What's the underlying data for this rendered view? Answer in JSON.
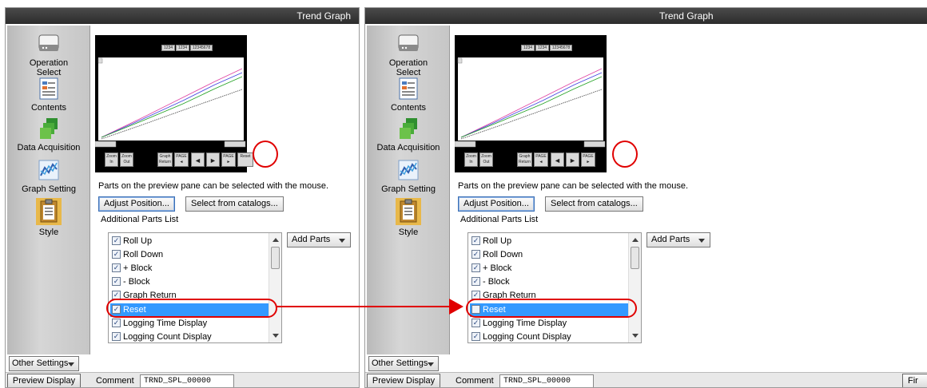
{
  "window": {
    "title": "Trend Graph"
  },
  "sidebar": {
    "items": [
      {
        "label": "Operation\nSelect",
        "icon": "drive-icon"
      },
      {
        "label": "Contents",
        "icon": "list-document-icon"
      },
      {
        "label": "Data Acquisition",
        "icon": "stacked-squares-icon"
      },
      {
        "label": "Graph Setting",
        "icon": "line-graph-icon"
      },
      {
        "label": "Style",
        "icon": "clipboard-icon",
        "active": true
      }
    ],
    "other_settings": "Other Settings"
  },
  "preview": {
    "header_boxes": [
      "1234",
      "1234",
      "12345678"
    ],
    "axis_left_top": "1",
    "axis_left_bottom": "12345678",
    "axis_right_bottom": "12345678",
    "controls": [
      {
        "label": "Zoom\nIn"
      },
      {
        "label": "Zoom\nOut"
      },
      {
        "label": "Graph\nReturn"
      },
      {
        "label": "PAGE\n◄"
      },
      {
        "label": "◄"
      },
      {
        "label": "►"
      },
      {
        "label": "PAGE\n►"
      },
      {
        "label": "Reset"
      },
      {
        "label": "Title"
      }
    ],
    "series_colors": [
      "#e040a0",
      "#4040e0",
      "#20a020",
      "#404040"
    ]
  },
  "hint": "Parts on the preview pane can be selected with the mouse.",
  "buttons": {
    "adjust_position": "Adjust Position...",
    "select_catalogs": "Select from catalogs..."
  },
  "additional_parts": {
    "header": "Additional Parts List",
    "add_parts": "Add Parts",
    "left_items": [
      {
        "label": "Roll Up",
        "checked": true
      },
      {
        "label": "Roll Down",
        "checked": true
      },
      {
        "label": "+ Block",
        "checked": true
      },
      {
        "label": "- Block",
        "checked": true
      },
      {
        "label": "Graph Return",
        "checked": true
      },
      {
        "label": "Reset",
        "checked": true,
        "selected": true
      },
      {
        "label": "Logging Time Display",
        "checked": true
      },
      {
        "label": "Logging Count Display",
        "checked": true
      }
    ],
    "right_items": [
      {
        "label": "Roll Up",
        "checked": true
      },
      {
        "label": "Roll Down",
        "checked": true
      },
      {
        "label": "+ Block",
        "checked": true
      },
      {
        "label": "- Block",
        "checked": true
      },
      {
        "label": "Graph Return",
        "checked": true
      },
      {
        "label": "Reset",
        "checked": false,
        "selected": true
      },
      {
        "label": "Logging Time Display",
        "checked": true
      },
      {
        "label": "Logging Count Display",
        "checked": true
      }
    ]
  },
  "footer": {
    "preview_display": "Preview Display",
    "comment_label": "Comment",
    "comment_value": "TRND_SPL_00000",
    "right_button": "Fir"
  },
  "colors": {
    "highlight": "#e00000",
    "selection": "#3399ff",
    "titlebar": "#333333"
  }
}
